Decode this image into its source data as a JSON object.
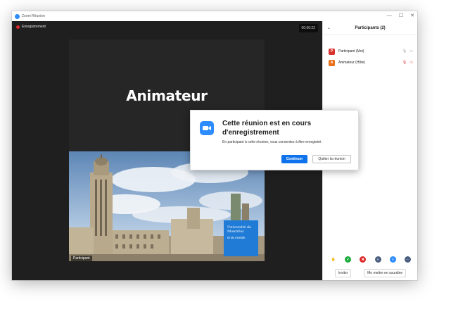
{
  "window": {
    "title": "Zoom Réunion",
    "controls": [
      "—",
      "☐",
      "✕"
    ]
  },
  "video": {
    "recording_label": "Enregistrement",
    "timer": "00:00:22",
    "slide_title": "Animateur",
    "participant_label": "Participant",
    "logo": {
      "name": "Université de Montréal",
      "tagline": "et du monde."
    }
  },
  "panel": {
    "title": "Participants (2)",
    "participants": [
      {
        "initial": "P",
        "name": "Participant (Moi)",
        "color": "#d9322e"
      },
      {
        "initial": "A",
        "name": "Animateur (Hôte)",
        "color": "#e8701a"
      }
    ],
    "reactions": [
      {
        "icon": "✋",
        "color": "#ffffff"
      },
      {
        "icon": "✔",
        "color": "#1dab3d"
      },
      {
        "icon": "✖",
        "color": "#e02828"
      },
      {
        "icon": "«",
        "color": "#4a5f80"
      },
      {
        "icon": "»",
        "color": "#2d8cff"
      },
      {
        "icon": "⋯",
        "color": "#4a5f80"
      }
    ],
    "invite_label": "Inviter",
    "mute_label": "Me mettre en sourdine"
  },
  "dialog": {
    "title": "Cette réunion est en cours d'enregistrement",
    "body": "En participant à cette réunion, vous consentez à être enregistré.",
    "continue_label": "Continuer",
    "leave_label": "Quitter la réunion"
  },
  "colors": {
    "accent": "#0e72ed",
    "zoom_blue": "#2d8cff",
    "record_red": "#e02828"
  }
}
